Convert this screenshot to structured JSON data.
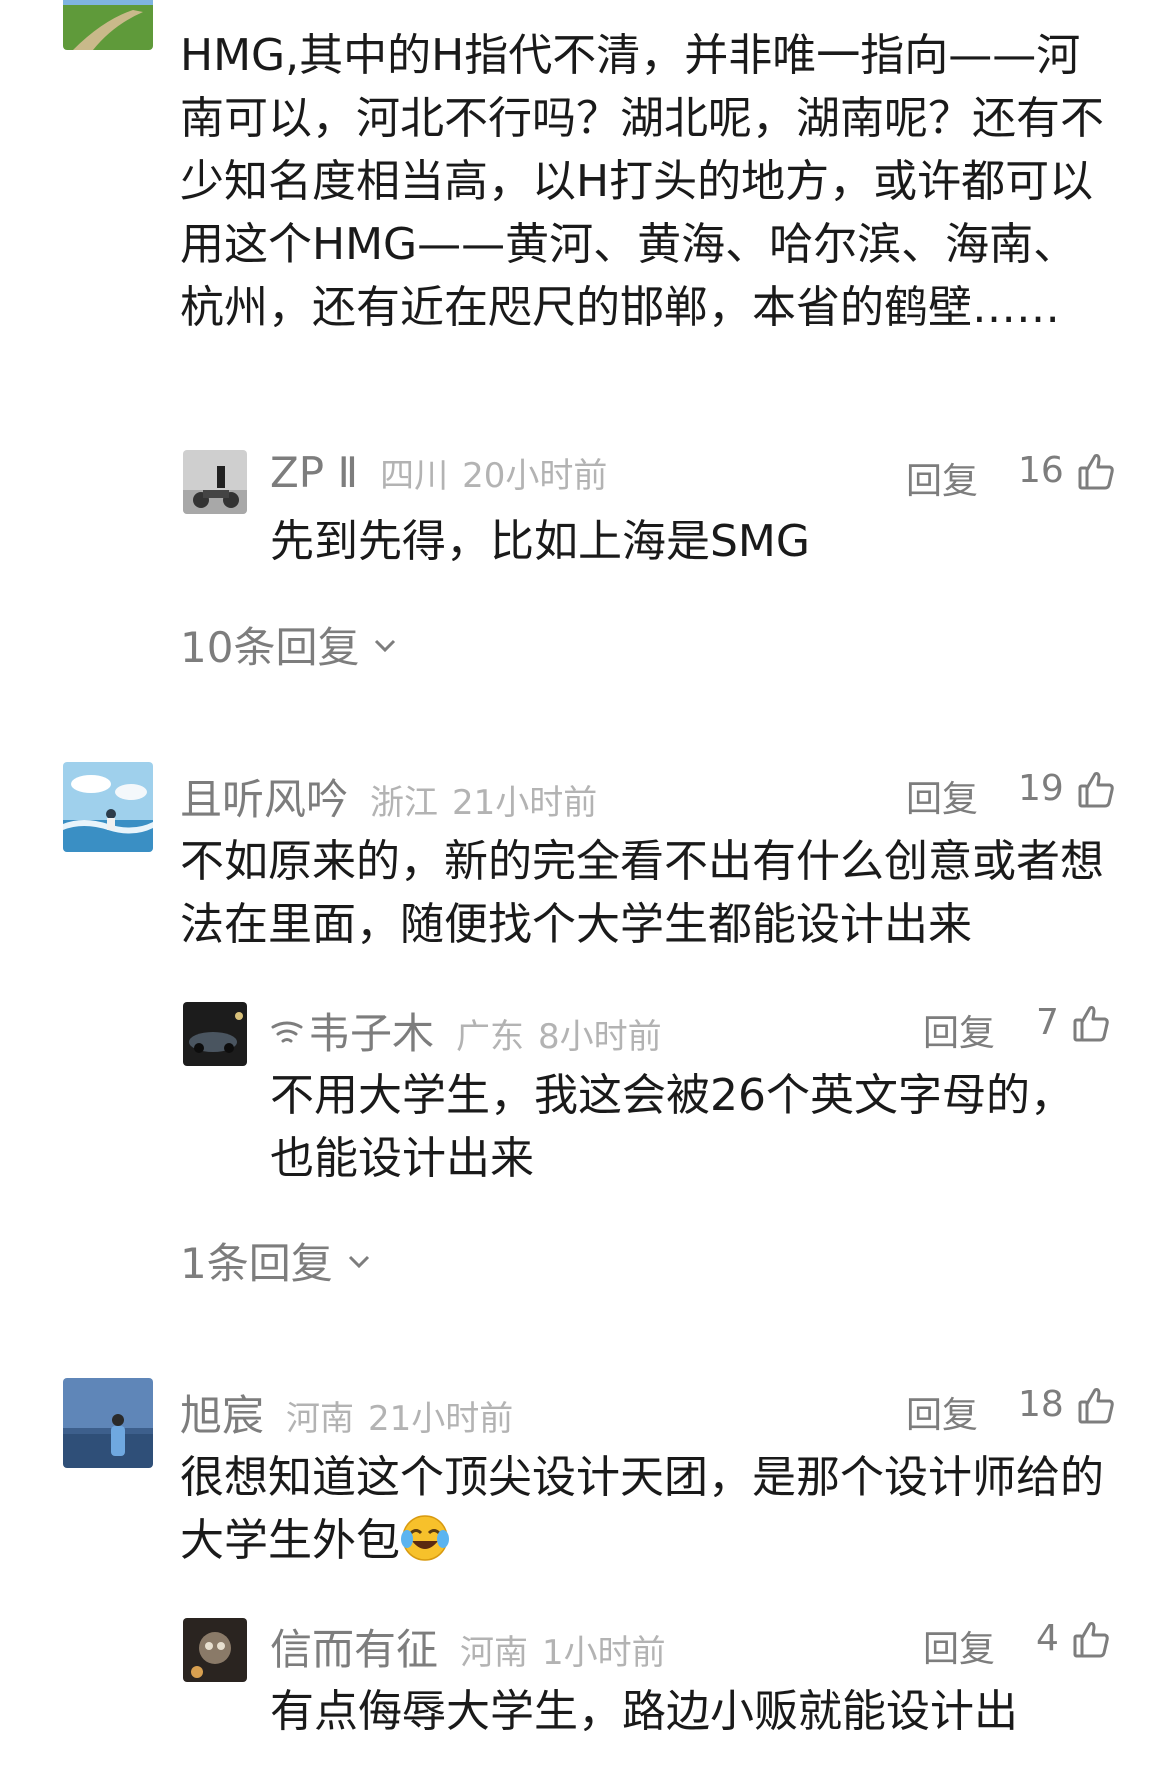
{
  "comments": [
    {
      "text": "HMG,其中的H指代不清，并非唯一指向——河南可以，河北不行吗？湖北呢，湖南呢？还有不少知名度相当高，以H打头的地方，或许都可以用这个HMG——黄河、黄海、哈尔滨、海南、杭州，还有近在咫尺的邯郸，本省的鹤壁……",
      "reply": {
        "user": "ZP Ⅱ",
        "location": "四川",
        "time": "20小时前",
        "reply_label": "回复",
        "likes": "16",
        "text": "先到先得，比如上海是SMG"
      },
      "more_replies": "10条回复"
    },
    {
      "user": "且听风吟",
      "location": "浙江",
      "time": "21小时前",
      "reply_label": "回复",
      "likes": "19",
      "text": "不如原来的，新的完全看不出有什么创意或者想法在里面，随便找个大学生都能设计出来",
      "reply": {
        "user": "韦子木",
        "location": "广东",
        "time": "8小时前",
        "reply_label": "回复",
        "likes": "7",
        "text": "不用大学生，我这会被26个英文字母的，也能设计出来"
      },
      "more_replies": "1条回复"
    },
    {
      "user": "旭宸",
      "location": "河南",
      "time": "21小时前",
      "reply_label": "回复",
      "likes": "18",
      "text": "很想知道这个顶尖设计天团，是那个设计师给的大学生外包",
      "reply": {
        "user": "信而有征",
        "location": "河南",
        "time": "1小时前",
        "reply_label": "回复",
        "likes": "4",
        "text": "有点侮辱大学生，路边小贩就能设计出"
      }
    }
  ],
  "icons": {
    "like": "thumbs-up-icon",
    "expand": "chevron-down-icon",
    "badge": "wifi-badge-icon",
    "emoji": "crying-laughing-emoji"
  },
  "colors": {
    "text": "#1a1a1a",
    "secondary": "#7d7d7d",
    "meta": "#b3b3b3"
  }
}
